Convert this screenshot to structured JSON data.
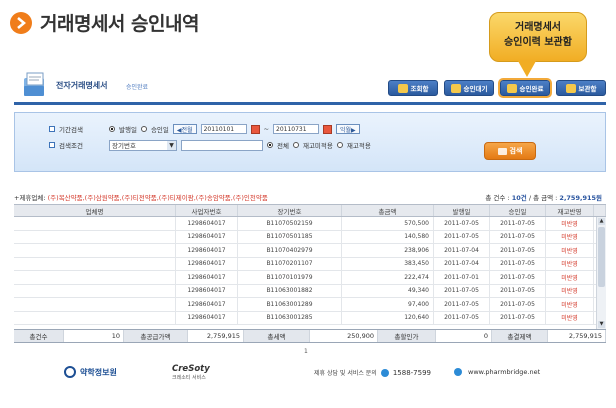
{
  "page": {
    "title": "거래명세서 승인내역",
    "callout_line1": "거래명세서",
    "callout_line2": "승인이력 보관함"
  },
  "app": {
    "title": "전자거래명세서",
    "subtitle": "승인완료",
    "top_buttons": [
      {
        "label": "조회함"
      },
      {
        "label": "승인대기"
      },
      {
        "label": "승인완료"
      },
      {
        "label": "보관함"
      }
    ]
  },
  "search": {
    "period_label": "기간검색",
    "radio_issue": "발행일",
    "radio_approve": "승인일",
    "prev_btn": "◀전월",
    "date_from": "20110101",
    "tilde": "~",
    "date_to": "20110731",
    "next_btn": "익월▶",
    "cond_label": "검색조건",
    "cond_select": "장기번호",
    "radio_all": "전체",
    "radio_not_reflected": "재고미적용",
    "radio_reflected": "재고적용",
    "search_button": "검색"
  },
  "summary": {
    "prefix": "+제휴업체:",
    "companies": "(주)복산약품,(주)삼원약품,(주)티전약품,(주)티제이팜,(주)송암약품,(주)인천약품",
    "count_label": "총 건수 :",
    "count_value": "10건",
    "amount_label": "/ 총 금액 :",
    "amount_value": "2,759,915원"
  },
  "table": {
    "headers": [
      "업체명",
      "사업자번호",
      "장기번호",
      "총금액",
      "발행일",
      "승인일",
      "재고반영"
    ],
    "rows": [
      {
        "company": "",
        "bizno": "1298604017",
        "invoice": "B11070502159",
        "amount": "570,500",
        "issued": "2011-07-05",
        "approved": "2011-07-05",
        "stock": "미반영"
      },
      {
        "company": "",
        "bizno": "1298604017",
        "invoice": "B11070501185",
        "amount": "140,580",
        "issued": "2011-07-05",
        "approved": "2011-07-05",
        "stock": "미반영"
      },
      {
        "company": "",
        "bizno": "1298604017",
        "invoice": "B11070402979",
        "amount": "238,906",
        "issued": "2011-07-04",
        "approved": "2011-07-05",
        "stock": "미반영"
      },
      {
        "company": "",
        "bizno": "1298604017",
        "invoice": "B11070201107",
        "amount": "383,450",
        "issued": "2011-07-04",
        "approved": "2011-07-05",
        "stock": "미반영"
      },
      {
        "company": "",
        "bizno": "1298604017",
        "invoice": "B11070101979",
        "amount": "222,474",
        "issued": "2011-07-01",
        "approved": "2011-07-05",
        "stock": "미반영"
      },
      {
        "company": "",
        "bizno": "1298604017",
        "invoice": "B11063001882",
        "amount": "49,340",
        "issued": "2011-07-05",
        "approved": "2011-07-05",
        "stock": "미반영"
      },
      {
        "company": "",
        "bizno": "1298604017",
        "invoice": "B11063001289",
        "amount": "97,400",
        "issued": "2011-07-05",
        "approved": "2011-07-05",
        "stock": "미반영"
      },
      {
        "company": "",
        "bizno": "1298604017",
        "invoice": "B11063001285",
        "amount": "120,640",
        "issued": "2011-07-05",
        "approved": "2011-07-05",
        "stock": "미반영"
      }
    ],
    "footer": {
      "count_label": "총건수",
      "count_value": "10",
      "supply_label": "총공급가액",
      "supply_value": "2,759,915",
      "tax_label": "총세액",
      "tax_value": "250,900",
      "deposit_label": "총할인가",
      "deposit_value": "0",
      "total_label": "총결제액",
      "total_value": "2,759,915"
    },
    "page_number": "1"
  },
  "footer": {
    "org_name": "약학정보원",
    "partner_name": "CreSoty",
    "partner_sub": "크레소티 서비스",
    "contact_label": "제휴 상담 및 서비스 문의",
    "phone": "1588-7599",
    "website": "www.pharmbridge.net"
  },
  "colors": {
    "accent_orange": "#f07d1a",
    "nav_blue": "#2f63a8",
    "alert_red": "#d4392b"
  }
}
